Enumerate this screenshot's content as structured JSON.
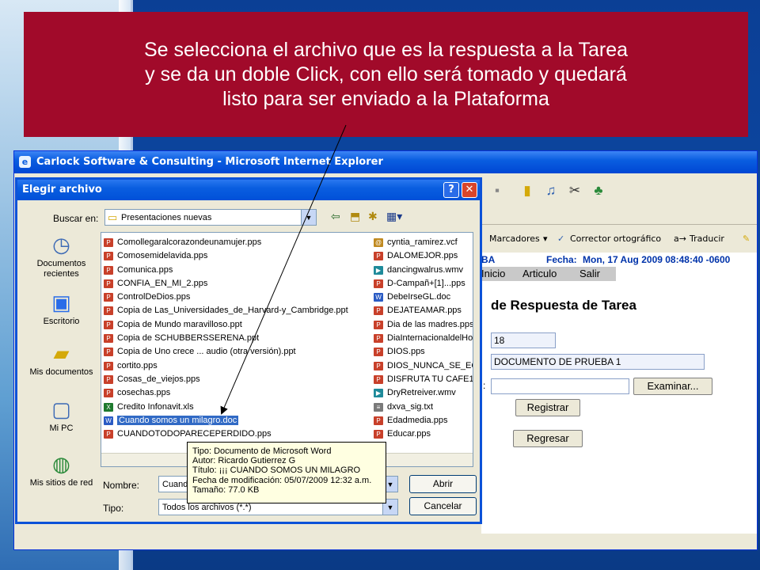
{
  "banner": {
    "line1": "Se selecciona el archivo que es la respuesta a la Tarea",
    "line2": "y se da un doble Click, con ello será tomado y quedará",
    "line3": "listo para ser enviado a la Plataforma"
  },
  "ie": {
    "title": "Carlock Software & Consulting - Microsoft Internet Explorer",
    "bar2": {
      "bookmarks": "Marcadores",
      "spell": "Corrector ortográfico",
      "translate": "Traducir"
    },
    "header": {
      "left": "BA",
      "fecha_label": "Fecha:",
      "fecha_value": "Mon, 17 Aug 2009 08:48:40 -0600"
    },
    "menu": [
      "Inicio",
      "Articulo",
      "Salir"
    ],
    "page_title": "de Respuesta de Tarea",
    "field1": "18",
    "field2": "DOCUMENTO DE PRUEBA 1",
    "field3_label": ":",
    "examinar": "Examinar...",
    "registrar": "Registrar",
    "regresar": "Regresar"
  },
  "dialog": {
    "title": "Elegir archivo",
    "lookin_label": "Buscar en:",
    "lookin_value": "Presentaciones nuevas",
    "places": [
      "Documentos recientes",
      "Escritorio",
      "Mis documentos",
      "Mi PC",
      "Mis sitios de red"
    ],
    "files_col1": [
      "Comollegaralcorazondeunamujer.pps",
      "Comosemidelavida.pps",
      "Comunica.pps",
      "CONFIA_EN_MI_2.pps",
      "ControlDeDios.pps",
      "Copia de Las_Universidades_de_Harvard-y_Cambridge.ppt",
      "Copia de Mundo maravilloso.ppt",
      "Copia de SCHUBBERSSERENA.ppt",
      "Copia de Uno crece ... audio (otra versión).ppt",
      "cortito.pps",
      "Cosas_de_viejos.pps",
      "cosechas.pps",
      "Credito Infonavit.xls",
      "Cuando somos un milagro.doc",
      "CUANDOTODOPARECEPERDIDO.pps"
    ],
    "files_col2": [
      "cyntia_ramirez.vcf",
      "DALOMEJOR.pps",
      "dancingwalrus.wmv",
      "D-Campañ+[1]...pps",
      "DebeIrseGL.doc",
      "DEJATEAMAR.pps",
      "Dia de las madres.pps",
      "DiaInternacionaldelHo",
      "DIOS.pps",
      "DIOS_NUNCA_SE_EQ",
      "DISFRUTA TU CAFE1.",
      "DryRetreiver.wmv",
      "dxva_sig.txt",
      "Edadmedia.pps",
      "Educar.pps"
    ],
    "selected_file": "Cuando somos un milagro.doc",
    "tooltip": {
      "l1": "Tipo: Documento de Microsoft Word",
      "l2": "Autor: Ricardo Gutierrez G",
      "l3": "Título: ¡¡¡  CUANDO SOMOS UN MILAGRO",
      "l4": "Fecha de modificación: 05/07/2009 12:32 a.m.",
      "l5": "Tamaño: 77.0 KB"
    },
    "name_label": "Nombre:",
    "name_value": "Cuando somos un milagro.doc",
    "type_label": "Tipo:",
    "type_value": "Todos los archivos (*.*)",
    "open_button": "Abrir",
    "cancel_button": "Cancelar"
  }
}
